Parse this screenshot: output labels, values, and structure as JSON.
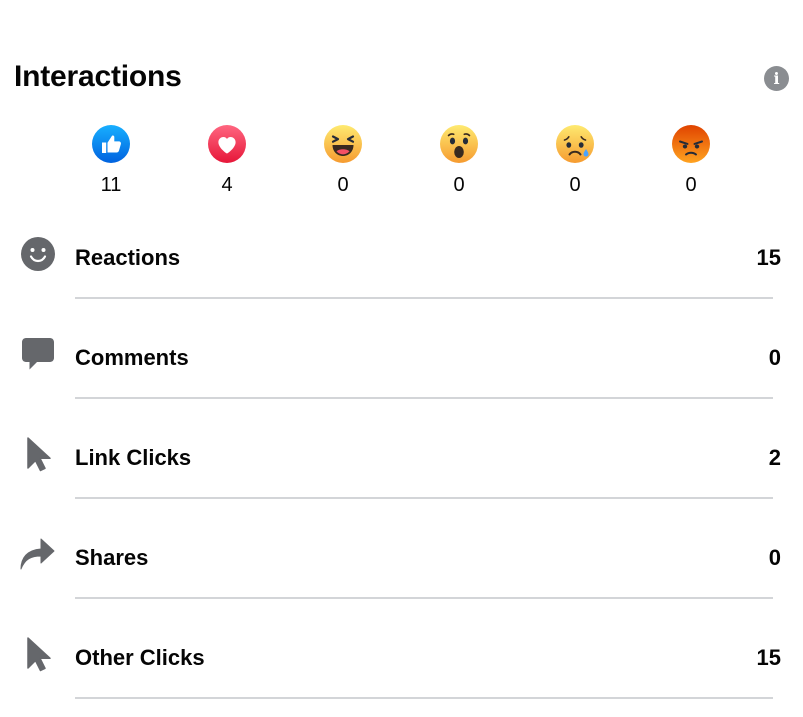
{
  "header": {
    "title": "Interactions",
    "info_icon": "info-icon",
    "info_glyph": "i"
  },
  "reactions": [
    {
      "name": "like",
      "icon": "like-icon",
      "count": "11"
    },
    {
      "name": "love",
      "icon": "love-icon",
      "count": "4"
    },
    {
      "name": "haha",
      "icon": "haha-icon",
      "count": "0"
    },
    {
      "name": "wow",
      "icon": "wow-icon",
      "count": "0"
    },
    {
      "name": "sad",
      "icon": "sad-icon",
      "count": "0"
    },
    {
      "name": "angry",
      "icon": "angry-icon",
      "count": "0"
    }
  ],
  "metrics": [
    {
      "label": "Reactions",
      "value": "15",
      "icon": "smiley-icon"
    },
    {
      "label": "Comments",
      "value": "0",
      "icon": "comment-bubble-icon"
    },
    {
      "label": "Link Clicks",
      "value": "2",
      "icon": "cursor-icon"
    },
    {
      "label": "Shares",
      "value": "0",
      "icon": "share-arrow-icon"
    },
    {
      "label": "Other Clicks",
      "value": "15",
      "icon": "cursor-icon"
    }
  ],
  "colors": {
    "like_blue": "#1877f2",
    "love_red": "#f33e58",
    "emoji_yellow": "#f7b125",
    "angry_orange": "#e9710f",
    "icon_gray": "#65676b",
    "divider": "#d3d5d8"
  }
}
